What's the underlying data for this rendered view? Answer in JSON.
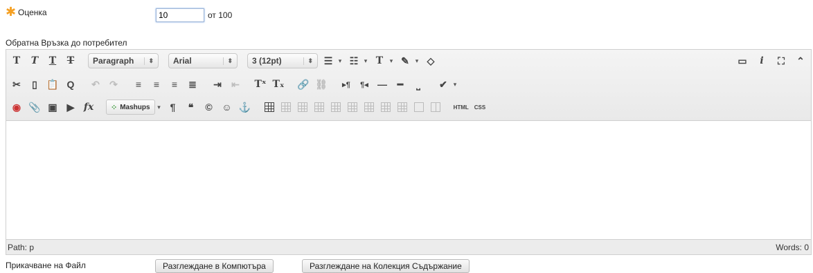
{
  "grade": {
    "label": "Оценка",
    "value": "10",
    "suffix": "от 100",
    "required_color": "#f5a023"
  },
  "feedback": {
    "label": "Обратна Връзка до потребител"
  },
  "editor": {
    "format_select": "Paragraph",
    "font_select": "Arial",
    "size_select": "3 (12pt)",
    "mashups_label": "Mashups",
    "html_label": "HTML",
    "css_label": "CSS",
    "path": "Path: p",
    "words": "Words: 0"
  },
  "attach": {
    "label": "Прикачване на Файл",
    "browse_computer": "Разглеждане в Компютъра",
    "browse_collection": "Разглеждане на Колекция Съдържание"
  }
}
